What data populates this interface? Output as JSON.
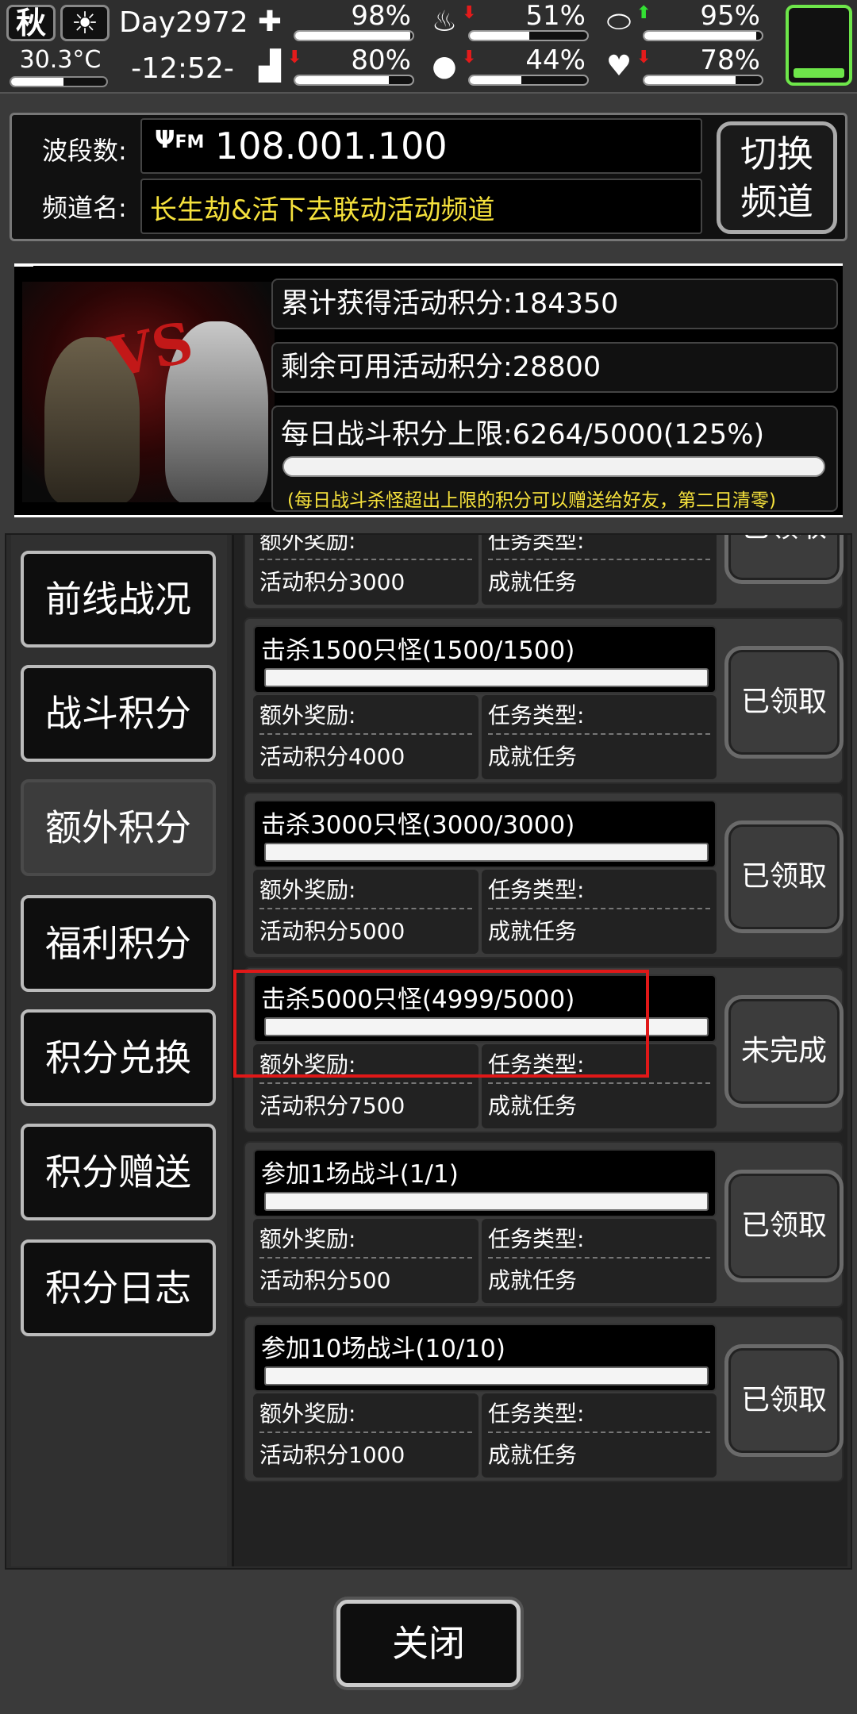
{
  "status": {
    "season": "秋",
    "weather_icon": "sun-icon",
    "temperature": "30.3°C",
    "day": "Day2972",
    "clock": "-12:52-",
    "stats": [
      {
        "name": "health",
        "icon": "medkit-icon",
        "pct": "98%",
        "level": 0.98,
        "arrow": ""
      },
      {
        "name": "hunger",
        "icon": "stomach-icon",
        "pct": "51%",
        "level": 0.51,
        "arrow": "down"
      },
      {
        "name": "immunity",
        "icon": "pill-icon",
        "pct": "95%",
        "level": 0.95,
        "arrow": "up"
      },
      {
        "name": "stamina",
        "icon": "boot-icon",
        "pct": "80%",
        "level": 0.8,
        "arrow": "down"
      },
      {
        "name": "thirst",
        "icon": "water-drop-icon",
        "pct": "44%",
        "level": 0.44,
        "arrow": "down"
      },
      {
        "name": "mood",
        "icon": "heart-icon",
        "pct": "78%",
        "level": 0.78,
        "arrow": "down"
      }
    ],
    "battery_color": "#6ee64a"
  },
  "radio": {
    "freq_label": "波段数:",
    "freq_value": "108.001.100",
    "fm_icon_text": "FM",
    "channel_label": "频道名:",
    "channel_value": "长生劫&活下去联动活动频道",
    "channel_color": "#f5e13c",
    "switch_line1": "切换",
    "switch_line2": "频道"
  },
  "score": {
    "vs_text": "VS",
    "total": "累计获得活动积分:184350",
    "available": "剩余可用活动积分:28800",
    "daily_limit": "每日战斗积分上限:6264/5000(125%)",
    "daily_level": 1.0,
    "note": "(每日战斗杀怪超出上限的积分可以赠送给好友，第二日清零)"
  },
  "nav": [
    {
      "label": "前线战况",
      "active": false
    },
    {
      "label": "战斗积分",
      "active": false
    },
    {
      "label": "额外积分",
      "active": true
    },
    {
      "label": "福利积分",
      "active": false
    },
    {
      "label": "积分兑换",
      "active": false
    },
    {
      "label": "积分赠送",
      "active": false
    },
    {
      "label": "积分日志",
      "active": false
    }
  ],
  "tasks": [
    {
      "title": "",
      "progress": 1.0,
      "reward_label": "额外奖励:",
      "reward_value": "活动积分3000",
      "type_label": "任务类型:",
      "type_value": "成就任务",
      "button": "已领取"
    },
    {
      "title": "击杀1500只怪(1500/1500)",
      "progress": 1.0,
      "reward_label": "额外奖励:",
      "reward_value": "活动积分4000",
      "type_label": "任务类型:",
      "type_value": "成就任务",
      "button": "已领取"
    },
    {
      "title": "击杀3000只怪(3000/3000)",
      "progress": 1.0,
      "reward_label": "额外奖励:",
      "reward_value": "活动积分5000",
      "type_label": "任务类型:",
      "type_value": "成就任务",
      "button": "已领取"
    },
    {
      "title": "击杀5000只怪(4999/5000)",
      "progress": 0.9998,
      "reward_label": "额外奖励:",
      "reward_value": "活动积分7500",
      "type_label": "任务类型:",
      "type_value": "成就任务",
      "button": "未完成"
    },
    {
      "title": "参加1场战斗(1/1)",
      "progress": 1.0,
      "reward_label": "额外奖励:",
      "reward_value": "活动积分500",
      "type_label": "任务类型:",
      "type_value": "成就任务",
      "button": "已领取"
    },
    {
      "title": "参加10场战斗(10/10)",
      "progress": 1.0,
      "reward_label": "额外奖励:",
      "reward_value": "活动积分1000",
      "type_label": "任务类型:",
      "type_value": "成就任务",
      "button": "已领取"
    }
  ],
  "highlight_color": "#e01818",
  "close_label": "关闭"
}
